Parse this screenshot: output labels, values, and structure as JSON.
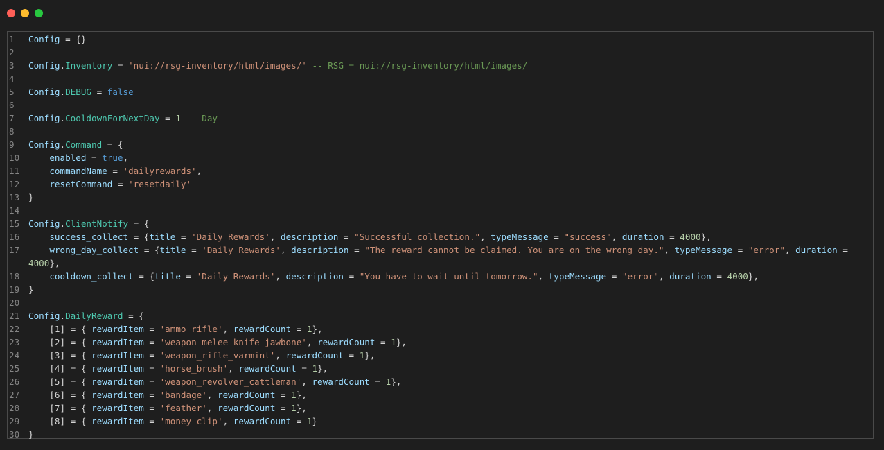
{
  "window": {
    "controls": {
      "close_color": "#ff5f57",
      "minimize_color": "#febc2e",
      "maximize_color": "#28c840"
    }
  },
  "editor": {
    "line_numbers": [
      "1",
      "2",
      "3",
      "4",
      "5",
      "6",
      "7",
      "8",
      "9",
      "10",
      "11",
      "12",
      "13",
      "14",
      "15",
      "16",
      "17",
      "18",
      "19",
      "20",
      "21",
      "22",
      "23",
      "24",
      "25",
      "26",
      "27",
      "28",
      "29",
      "30"
    ],
    "lines": [
      [
        {
          "t": "Config",
          "c": "id"
        },
        {
          "t": " = {}",
          "c": "op"
        }
      ],
      [],
      [
        {
          "t": "Config",
          "c": "id"
        },
        {
          "t": ".",
          "c": "op"
        },
        {
          "t": "Inventory",
          "c": "prop"
        },
        {
          "t": " = ",
          "c": "op"
        },
        {
          "t": "'nui://rsg-inventory/html/images/'",
          "c": "str"
        },
        {
          "t": " -- RSG = nui://rsg-inventory/html/images/",
          "c": "com"
        }
      ],
      [],
      [
        {
          "t": "Config",
          "c": "id"
        },
        {
          "t": ".",
          "c": "op"
        },
        {
          "t": "DEBUG",
          "c": "prop"
        },
        {
          "t": " = ",
          "c": "op"
        },
        {
          "t": "false",
          "c": "kw"
        }
      ],
      [],
      [
        {
          "t": "Config",
          "c": "id"
        },
        {
          "t": ".",
          "c": "op"
        },
        {
          "t": "CooldownForNextDay",
          "c": "prop"
        },
        {
          "t": " = ",
          "c": "op"
        },
        {
          "t": "1",
          "c": "num"
        },
        {
          "t": " -- Day",
          "c": "com"
        }
      ],
      [],
      [
        {
          "t": "Config",
          "c": "id"
        },
        {
          "t": ".",
          "c": "op"
        },
        {
          "t": "Command",
          "c": "prop"
        },
        {
          "t": " = {",
          "c": "op"
        }
      ],
      [
        {
          "t": "    enabled",
          "c": "id"
        },
        {
          "t": " = ",
          "c": "op"
        },
        {
          "t": "true",
          "c": "kw"
        },
        {
          "t": ",",
          "c": "op"
        }
      ],
      [
        {
          "t": "    commandName",
          "c": "id"
        },
        {
          "t": " = ",
          "c": "op"
        },
        {
          "t": "'dailyrewards'",
          "c": "str"
        },
        {
          "t": ",",
          "c": "op"
        }
      ],
      [
        {
          "t": "    resetCommand",
          "c": "id"
        },
        {
          "t": " = ",
          "c": "op"
        },
        {
          "t": "'resetdaily'",
          "c": "str"
        }
      ],
      [
        {
          "t": "}",
          "c": "op"
        }
      ],
      [],
      [
        {
          "t": "Config",
          "c": "id"
        },
        {
          "t": ".",
          "c": "op"
        },
        {
          "t": "ClientNotify",
          "c": "prop"
        },
        {
          "t": " = {",
          "c": "op"
        }
      ],
      [
        {
          "t": "    success_collect",
          "c": "id"
        },
        {
          "t": " = {",
          "c": "op"
        },
        {
          "t": "title",
          "c": "id"
        },
        {
          "t": " = ",
          "c": "op"
        },
        {
          "t": "'Daily Rewards'",
          "c": "str"
        },
        {
          "t": ", ",
          "c": "op"
        },
        {
          "t": "description",
          "c": "id"
        },
        {
          "t": " = ",
          "c": "op"
        },
        {
          "t": "\"Successful collection.\"",
          "c": "str"
        },
        {
          "t": ", ",
          "c": "op"
        },
        {
          "t": "typeMessage",
          "c": "id"
        },
        {
          "t": " = ",
          "c": "op"
        },
        {
          "t": "\"success\"",
          "c": "str"
        },
        {
          "t": ", ",
          "c": "op"
        },
        {
          "t": "duration",
          "c": "id"
        },
        {
          "t": " = ",
          "c": "op"
        },
        {
          "t": "4000",
          "c": "num"
        },
        {
          "t": "},",
          "c": "op"
        }
      ],
      [
        {
          "t": "    wrong_day_collect",
          "c": "id"
        },
        {
          "t": " = {",
          "c": "op"
        },
        {
          "t": "title",
          "c": "id"
        },
        {
          "t": " = ",
          "c": "op"
        },
        {
          "t": "'Daily Rewards'",
          "c": "str"
        },
        {
          "t": ", ",
          "c": "op"
        },
        {
          "t": "description",
          "c": "id"
        },
        {
          "t": " = ",
          "c": "op"
        },
        {
          "t": "\"The reward cannot be claimed. You are on the wrong day.\"",
          "c": "str"
        },
        {
          "t": ", ",
          "c": "op"
        },
        {
          "t": "typeMessage",
          "c": "id"
        },
        {
          "t": " = ",
          "c": "op"
        },
        {
          "t": "\"error\"",
          "c": "str"
        },
        {
          "t": ", ",
          "c": "op"
        },
        {
          "t": "duration",
          "c": "id"
        },
        {
          "t": " =",
          "c": "op"
        }
      ],
      [
        {
          "t": "    cooldown_collect",
          "c": "id"
        },
        {
          "t": " = {",
          "c": "op"
        },
        {
          "t": "title",
          "c": "id"
        },
        {
          "t": " = ",
          "c": "op"
        },
        {
          "t": "'Daily Rewards'",
          "c": "str"
        },
        {
          "t": ", ",
          "c": "op"
        },
        {
          "t": "description",
          "c": "id"
        },
        {
          "t": " = ",
          "c": "op"
        },
        {
          "t": "\"You have to wait until tomorrow.\"",
          "c": "str"
        },
        {
          "t": ", ",
          "c": "op"
        },
        {
          "t": "typeMessage",
          "c": "id"
        },
        {
          "t": " = ",
          "c": "op"
        },
        {
          "t": "\"error\"",
          "c": "str"
        },
        {
          "t": ", ",
          "c": "op"
        },
        {
          "t": "duration",
          "c": "id"
        },
        {
          "t": " = ",
          "c": "op"
        },
        {
          "t": "4000",
          "c": "num"
        },
        {
          "t": "},",
          "c": "op"
        }
      ],
      [
        {
          "t": "}",
          "c": "op"
        }
      ],
      [],
      [
        {
          "t": "Config",
          "c": "id"
        },
        {
          "t": ".",
          "c": "op"
        },
        {
          "t": "DailyReward",
          "c": "prop"
        },
        {
          "t": " = {",
          "c": "op"
        }
      ],
      [
        {
          "t": "    [1] = { ",
          "c": "op"
        },
        {
          "t": "rewardItem",
          "c": "id"
        },
        {
          "t": " = ",
          "c": "op"
        },
        {
          "t": "'ammo_rifle'",
          "c": "str"
        },
        {
          "t": ", ",
          "c": "op"
        },
        {
          "t": "rewardCount",
          "c": "id"
        },
        {
          "t": " = ",
          "c": "op"
        },
        {
          "t": "1",
          "c": "num"
        },
        {
          "t": "},",
          "c": "op"
        }
      ],
      [
        {
          "t": "    [2] = { ",
          "c": "op"
        },
        {
          "t": "rewardItem",
          "c": "id"
        },
        {
          "t": " = ",
          "c": "op"
        },
        {
          "t": "'weapon_melee_knife_jawbone'",
          "c": "str"
        },
        {
          "t": ", ",
          "c": "op"
        },
        {
          "t": "rewardCount",
          "c": "id"
        },
        {
          "t": " = ",
          "c": "op"
        },
        {
          "t": "1",
          "c": "num"
        },
        {
          "t": "},",
          "c": "op"
        }
      ],
      [
        {
          "t": "    [3] = { ",
          "c": "op"
        },
        {
          "t": "rewardItem",
          "c": "id"
        },
        {
          "t": " = ",
          "c": "op"
        },
        {
          "t": "'weapon_rifle_varmint'",
          "c": "str"
        },
        {
          "t": ", ",
          "c": "op"
        },
        {
          "t": "rewardCount",
          "c": "id"
        },
        {
          "t": " = ",
          "c": "op"
        },
        {
          "t": "1",
          "c": "num"
        },
        {
          "t": "},",
          "c": "op"
        }
      ],
      [
        {
          "t": "    [4] = { ",
          "c": "op"
        },
        {
          "t": "rewardItem",
          "c": "id"
        },
        {
          "t": " = ",
          "c": "op"
        },
        {
          "t": "'horse_brush'",
          "c": "str"
        },
        {
          "t": ", ",
          "c": "op"
        },
        {
          "t": "rewardCount",
          "c": "id"
        },
        {
          "t": " = ",
          "c": "op"
        },
        {
          "t": "1",
          "c": "num"
        },
        {
          "t": "},",
          "c": "op"
        }
      ],
      [
        {
          "t": "    [5] = { ",
          "c": "op"
        },
        {
          "t": "rewardItem",
          "c": "id"
        },
        {
          "t": " = ",
          "c": "op"
        },
        {
          "t": "'weapon_revolver_cattleman'",
          "c": "str"
        },
        {
          "t": ", ",
          "c": "op"
        },
        {
          "t": "rewardCount",
          "c": "id"
        },
        {
          "t": " = ",
          "c": "op"
        },
        {
          "t": "1",
          "c": "num"
        },
        {
          "t": "},",
          "c": "op"
        }
      ],
      [
        {
          "t": "    [6] = { ",
          "c": "op"
        },
        {
          "t": "rewardItem",
          "c": "id"
        },
        {
          "t": " = ",
          "c": "op"
        },
        {
          "t": "'bandage'",
          "c": "str"
        },
        {
          "t": ", ",
          "c": "op"
        },
        {
          "t": "rewardCount",
          "c": "id"
        },
        {
          "t": " = ",
          "c": "op"
        },
        {
          "t": "1",
          "c": "num"
        },
        {
          "t": "},",
          "c": "op"
        }
      ],
      [
        {
          "t": "    [7] = { ",
          "c": "op"
        },
        {
          "t": "rewardItem",
          "c": "id"
        },
        {
          "t": " = ",
          "c": "op"
        },
        {
          "t": "'feather'",
          "c": "str"
        },
        {
          "t": ", ",
          "c": "op"
        },
        {
          "t": "rewardCount",
          "c": "id"
        },
        {
          "t": " = ",
          "c": "op"
        },
        {
          "t": "1",
          "c": "num"
        },
        {
          "t": "},",
          "c": "op"
        }
      ],
      [
        {
          "t": "    [8] = { ",
          "c": "op"
        },
        {
          "t": "rewardItem",
          "c": "id"
        },
        {
          "t": " = ",
          "c": "op"
        },
        {
          "t": "'money_clip'",
          "c": "str"
        },
        {
          "t": ", ",
          "c": "op"
        },
        {
          "t": "rewardCount",
          "c": "id"
        },
        {
          "t": " = ",
          "c": "op"
        },
        {
          "t": "1",
          "c": "num"
        },
        {
          "t": "}",
          "c": "op"
        }
      ],
      [
        {
          "t": "}",
          "c": "op"
        }
      ]
    ],
    "wraps": {
      "16": [
        {
          "t": "4000",
          "c": "num"
        },
        {
          "t": "},",
          "c": "op"
        }
      ]
    }
  }
}
